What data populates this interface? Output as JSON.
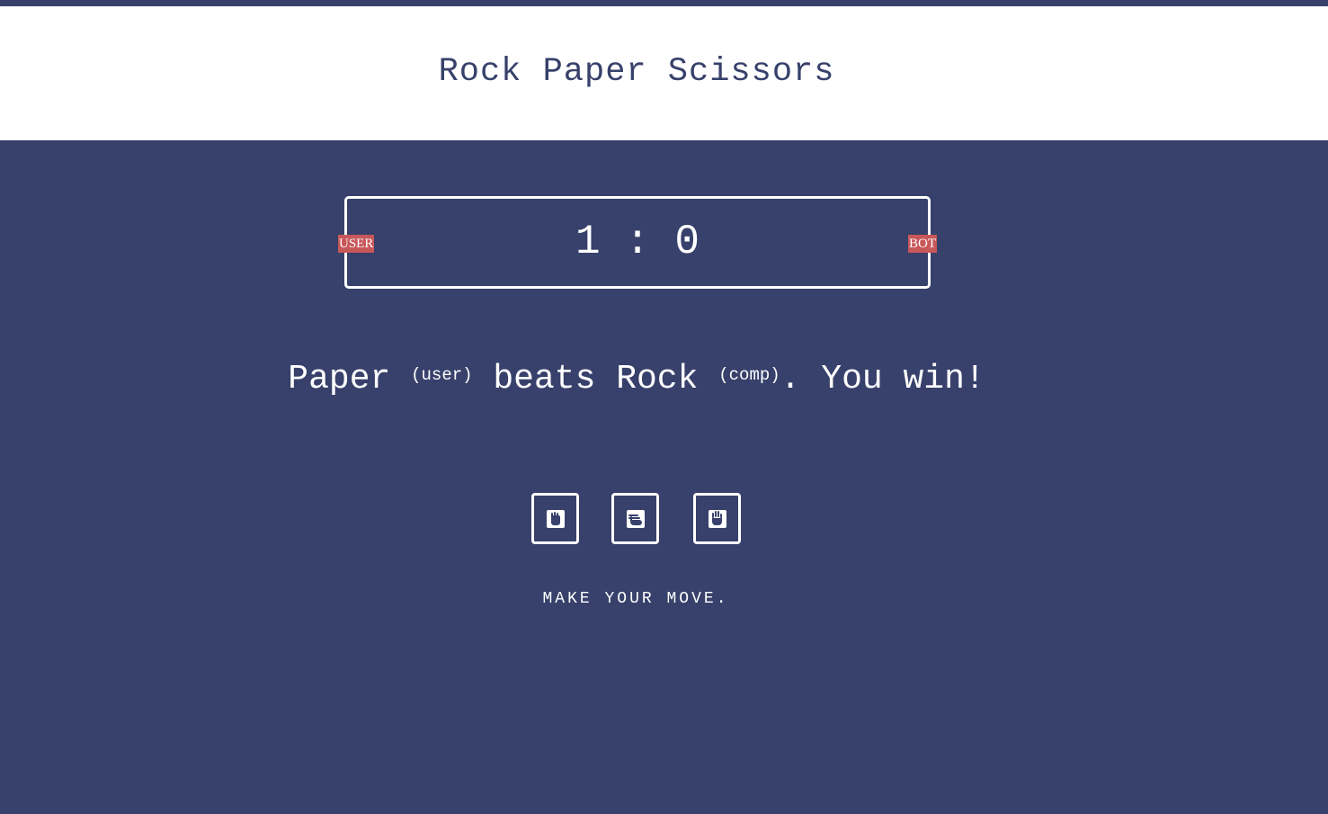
{
  "header": {
    "title": "Rock Paper Scissors"
  },
  "scoreboard": {
    "user_score": "1",
    "separator": ":",
    "bot_score": "0",
    "user_label": "USER",
    "bot_label": "BOT"
  },
  "result": {
    "user_choice": "Paper",
    "user_tag": "(user)",
    "verb": "beats",
    "comp_choice": "Rock",
    "comp_tag": "(comp)",
    "outcome": ". You win!"
  },
  "choices": [
    {
      "name": "rock",
      "icon": "fist-icon"
    },
    {
      "name": "paper",
      "icon": "flat-hand-icon"
    },
    {
      "name": "scissors",
      "icon": "open-hand-icon"
    }
  ],
  "instruction": "MAKE YOUR MOVE.",
  "colors": {
    "background": "#37416b",
    "header_bg": "#ffffff",
    "badge": "#c8575a",
    "text": "#ffffff"
  }
}
